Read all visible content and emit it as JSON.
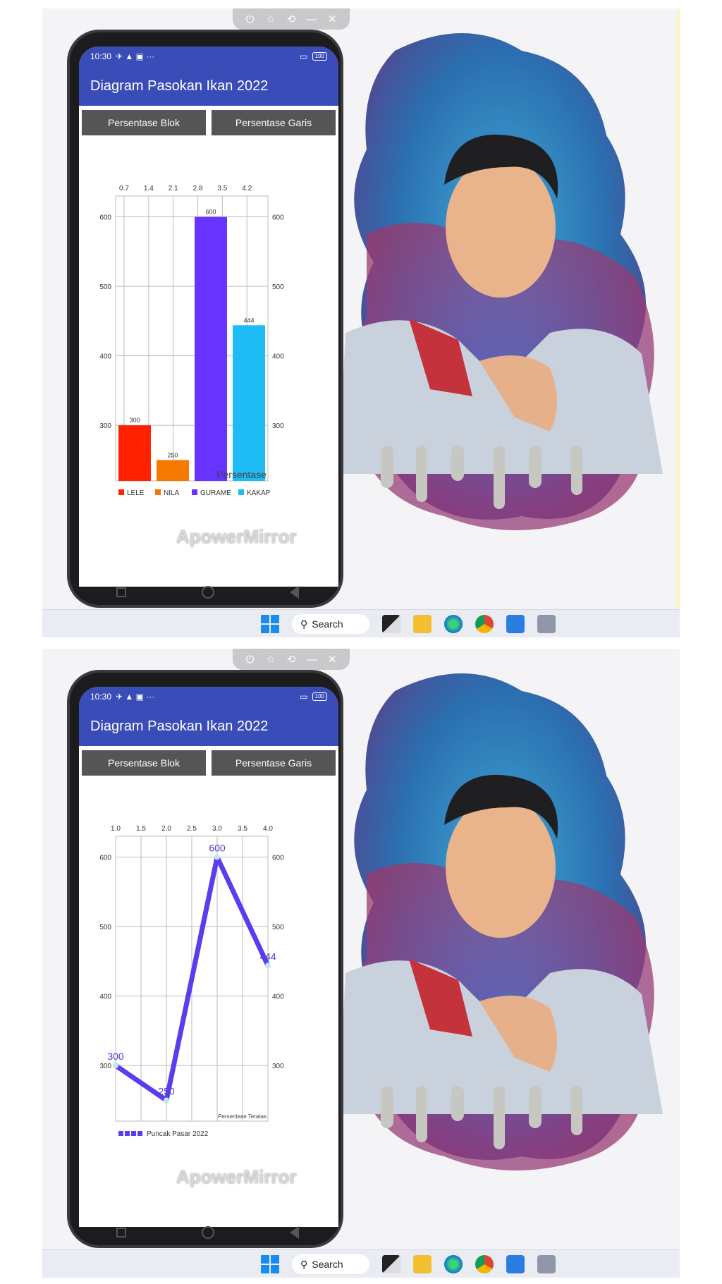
{
  "panels": [
    {
      "phone": {
        "status_time": "10:30",
        "status_extra": "✈ ▲ ▣ ···",
        "battery": "100",
        "app_title": "Diagram Pasokan Ikan 2022",
        "buttons": {
          "blok": "Persentase Blok",
          "garis": "Persentase Garis"
        },
        "watermark": "ApowerMirror"
      },
      "taskbar": {
        "search_label": "Search"
      }
    },
    {
      "phone": {
        "status_time": "10:30",
        "status_extra": "✈ ▲ ▣ ···",
        "battery": "100",
        "app_title": "Diagram Pasokan Ikan 2022",
        "buttons": {
          "blok": "Persentase Blok",
          "garis": "Persentase Garis"
        },
        "watermark": "ApowerMirror"
      },
      "taskbar": {
        "search_label": "Search"
      }
    }
  ],
  "mirror_controls": [
    "power-icon",
    "star-icon",
    "refresh-icon",
    "minimize-icon",
    "close-icon"
  ],
  "colors": {
    "appbar": "#3a4cb8",
    "button": "#555555",
    "lele": "#ff2200",
    "nila": "#f57900",
    "gurame": "#6633ff",
    "kakap": "#1ebcf5",
    "line": "#5b3df0"
  },
  "chart_data": [
    {
      "type": "bar",
      "title": "",
      "description_label": "Persentase",
      "categories": [
        "LELE",
        "NILA",
        "GURAME",
        "KAKAP"
      ],
      "values": [
        300,
        250,
        600,
        444
      ],
      "x_ticks": [
        "0.7",
        "1.4",
        "2.1",
        "2.8",
        "3.5",
        "4.2"
      ],
      "y_ticks": [
        300,
        400,
        500,
        600
      ],
      "ylim": [
        220,
        630
      ],
      "grid": true,
      "legend": "bottom-left"
    },
    {
      "type": "line",
      "title": "",
      "description_label": "Persentase Teratas",
      "series": [
        {
          "name": "Puncak Pasar 2022",
          "x": [
            1.0,
            2.0,
            3.0,
            4.0
          ],
          "values": [
            300,
            250,
            600,
            444
          ]
        }
      ],
      "x_ticks": [
        "1.0",
        "1.5",
        "2.0",
        "2.5",
        "3.0",
        "3.5",
        "4.0"
      ],
      "y_ticks": [
        300,
        400,
        500,
        600
      ],
      "ylim": [
        220,
        630
      ],
      "xlim": [
        1.0,
        4.0
      ],
      "grid": true,
      "legend": "bottom-left"
    }
  ]
}
